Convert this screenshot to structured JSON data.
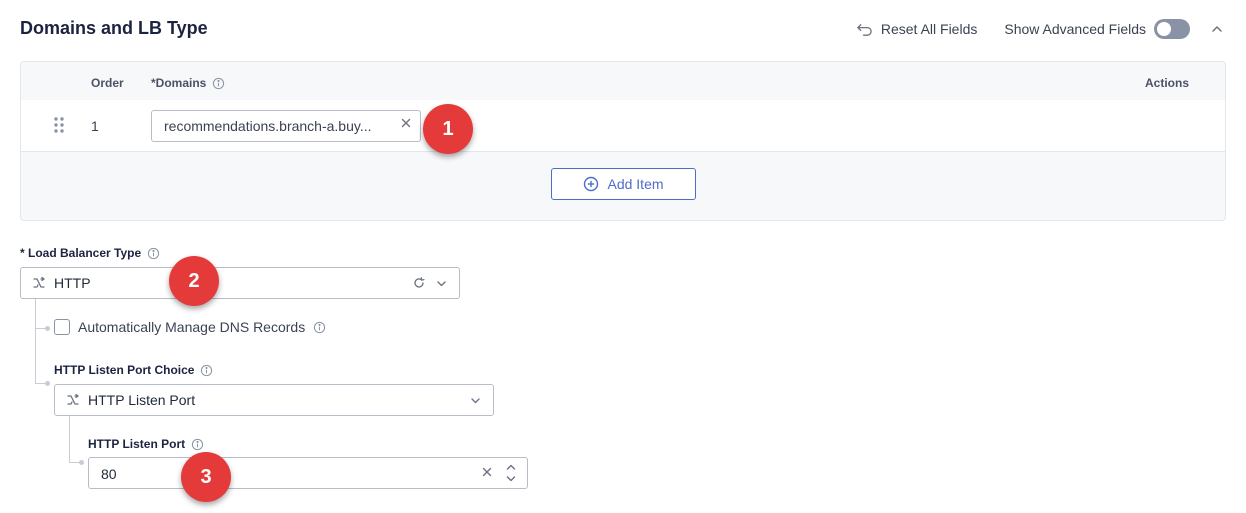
{
  "section": {
    "title": "Domains and LB Type"
  },
  "header": {
    "reset_label": "Reset All Fields",
    "advanced_label": "Show Advanced Fields",
    "advanced_enabled": false
  },
  "domains_table": {
    "columns": {
      "order": "Order",
      "domains": "*Domains",
      "actions": "Actions"
    },
    "rows": [
      {
        "order": "1",
        "domain": "recommendations.branch-a.buy..."
      }
    ],
    "add_item_label": "Add Item"
  },
  "lb_type": {
    "label": "* Load Balancer Type",
    "value": "HTTP"
  },
  "dns": {
    "label": "Automatically Manage DNS Records",
    "checked": false
  },
  "listen_port_choice": {
    "label": "HTTP Listen Port Choice",
    "value": "HTTP Listen Port"
  },
  "listen_port": {
    "label": "HTTP Listen Port",
    "value": "80"
  },
  "badges": [
    "1",
    "2",
    "3"
  ],
  "colors": {
    "accent": "#4f6cc8",
    "badge": "#e53a3a",
    "title": "#1c2340"
  },
  "icons": {
    "reset": "undo-arrow-icon",
    "collapse": "chevron-up-icon",
    "info": "info-icon",
    "drag": "drag-handle-icon",
    "add": "plus-circle-icon",
    "select_lead": "branch-icon",
    "refresh": "refresh-icon",
    "dropdown": "chevron-down-icon",
    "clear": "close-icon",
    "stepper": "stepper-icon"
  }
}
